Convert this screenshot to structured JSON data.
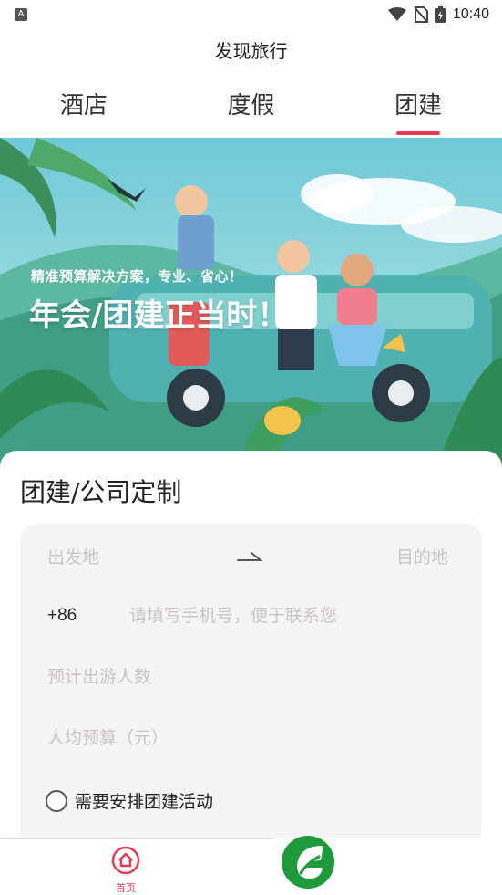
{
  "status_bar": {
    "notification_icon": "A",
    "time": "10:40",
    "icons": [
      "wifi-icon",
      "no-sim-icon",
      "battery-charging-icon"
    ]
  },
  "header": {
    "title": "发现旅行",
    "tabs": [
      {
        "label": "酒店",
        "active": false
      },
      {
        "label": "度假",
        "active": false
      },
      {
        "label": "团建",
        "active": true
      }
    ],
    "accent_color": "#e83a52"
  },
  "banner": {
    "subtitle": "精准预算解决方案，专业、省心！",
    "headline": "年会/团建正当时！"
  },
  "form": {
    "title": "团建/公司定制",
    "from_placeholder": "出发地",
    "to_placeholder": "目的地",
    "country_code": "+86",
    "phone_placeholder": "请填写手机号，便于联系您",
    "people_placeholder": "预计出游人数",
    "budget_placeholder": "人均预算（元）",
    "activity_option": {
      "label": "需要安排团建活动",
      "checked": false
    }
  },
  "bottom_nav": {
    "home_label": "首页",
    "home_icon": "home-icon",
    "center_icon": "leaf-logo-icon"
  }
}
